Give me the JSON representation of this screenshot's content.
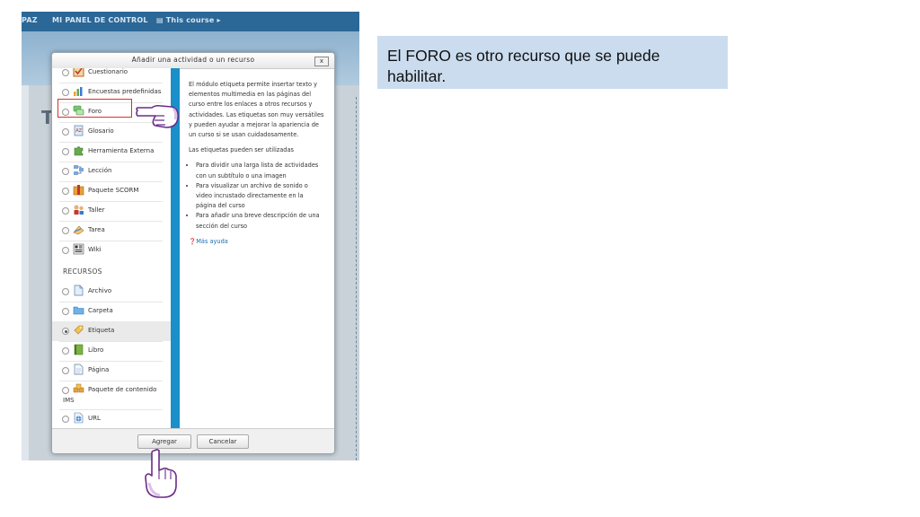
{
  "topnav": {
    "item_paz": "PAZ",
    "item_panel": "MI PANEL DE CONTROL",
    "item_course": "This course"
  },
  "background": {
    "title_letter": "T"
  },
  "modal": {
    "title": "Añadir una actividad o un recurso",
    "close_label": "x",
    "activities": [
      {
        "label": "Cuestionario",
        "icon": "quiz-icon"
      },
      {
        "label": "Encuestas predefinidas",
        "icon": "survey-chart-icon"
      },
      {
        "label": "Foro",
        "icon": "forum-icon"
      },
      {
        "label": "Glosario",
        "icon": "glossary-icon"
      },
      {
        "label": "Herramienta Externa",
        "icon": "puzzle-icon"
      },
      {
        "label": "Lección",
        "icon": "lesson-icon"
      },
      {
        "label": "Paquete SCORM",
        "icon": "scorm-package-icon"
      },
      {
        "label": "Taller",
        "icon": "workshop-icon"
      },
      {
        "label": "Tarea",
        "icon": "assignment-icon"
      },
      {
        "label": "Wiki",
        "icon": "wiki-icon"
      }
    ],
    "resources_heading": "RECURSOS",
    "resources": [
      {
        "label": "Archivo",
        "icon": "file-icon"
      },
      {
        "label": "Carpeta",
        "icon": "folder-icon"
      },
      {
        "label": "Etiqueta",
        "icon": "label-tag-icon"
      },
      {
        "label": "Libro",
        "icon": "book-icon"
      },
      {
        "label": "Página",
        "icon": "page-icon"
      },
      {
        "label": "Paquete de contenido",
        "label2": "IMS",
        "icon": "ims-package-icon"
      },
      {
        "label": "URL",
        "icon": "url-globe-icon"
      }
    ],
    "description": {
      "p1": "El módulo etiqueta permite insertar texto y elementos multimedia en las páginas del curso entre los enlaces a otros recursos y actividades. Las etiquetas son muy versátiles y pueden ayudar a mejorar la apariencia de un curso si se usan cuidadosamente.",
      "p2": "Las etiquetas pueden ser utilizadas",
      "bullets": [
        "Para dividir una larga lista de actividades con un subtítulo o una imagen",
        "Para visualizar un archivo de sonido o video incrustado directamente en la página del curso",
        "Para añadir una breve descripción de una sección del curso"
      ],
      "help_link": "Más ayuda"
    },
    "buttons": {
      "add": "Agregar",
      "cancel": "Cancelar"
    }
  },
  "caption": {
    "text": "El FORO es otro recurso que se puede habilitar."
  },
  "colors": {
    "topbar": "#2b6797",
    "divider": "#1a8fc9",
    "highlight": "#d9302c",
    "caption_bg": "#cbdcef"
  }
}
